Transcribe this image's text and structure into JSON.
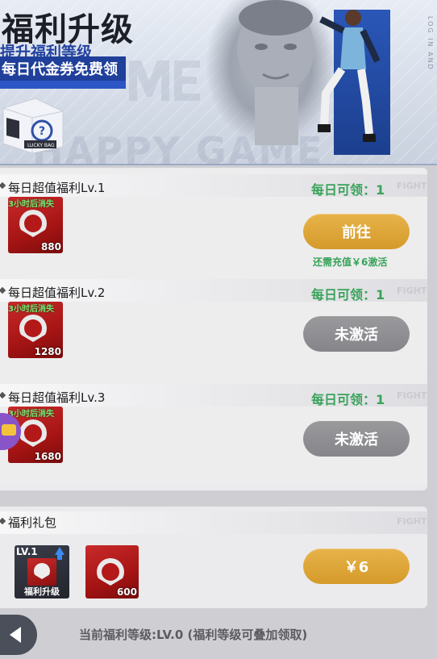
{
  "banner": {
    "title": "福利升级",
    "subtitle_1": "提升福利等级",
    "subtitle_2": "每日代金券免费领",
    "watermark": "HAPPY GAME",
    "side_text": "LOG IN AND",
    "lucky_bag_label": "LUCKY BAG"
  },
  "cards": [
    {
      "title": "每日超值福利Lv.1",
      "daily": "每日可领：1",
      "fight": "FIGHT",
      "coupon_tag": "3小时后消失",
      "coupon_amount": "880",
      "button": "前往",
      "button_state": "active",
      "hint": "还需充值￥6激活"
    },
    {
      "title": "每日超值福利Lv.2",
      "daily": "每日可领：1",
      "fight": "FIGHT",
      "coupon_tag": "3小时后消失",
      "coupon_amount": "1280",
      "button": "未激活",
      "button_state": "inactive"
    },
    {
      "title": "每日超值福利Lv.3",
      "daily": "每日可领：1",
      "fight": "FIGHT",
      "coupon_tag": "3小时后消失",
      "coupon_amount": "1680",
      "button": "未激活",
      "button_state": "inactive"
    }
  ],
  "gift": {
    "title": "福利礼包",
    "fight": "FIGHT",
    "item_level": "LV.1",
    "item_caption": "福利升级",
    "coupon_amount": "600",
    "price_button": "￥6"
  },
  "footer": {
    "level_text": "当前福利等级:LV.0 (福利等级可叠加领取)"
  },
  "colors": {
    "accent_green": "#39a35a",
    "gold_button": "#d59a2a",
    "inactive_button": "#8f8f93",
    "banner_blue": "#1f3f9a"
  }
}
